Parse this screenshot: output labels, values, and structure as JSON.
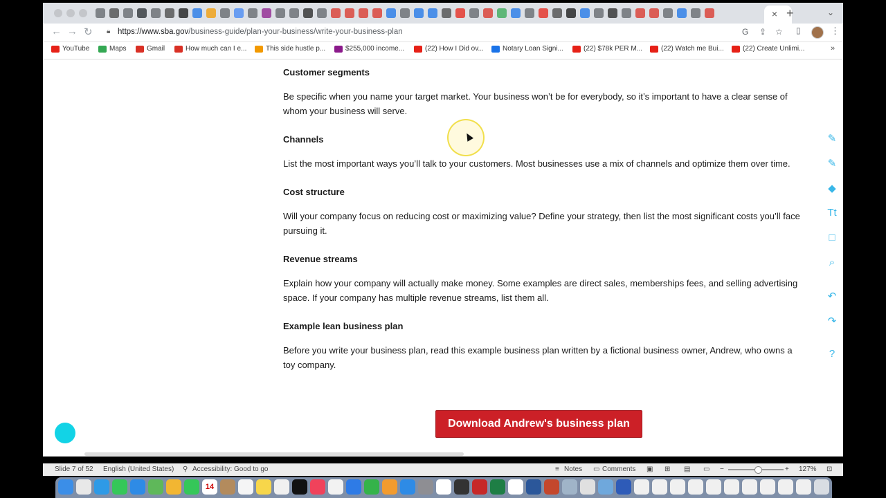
{
  "browser": {
    "url_host": "https://www.sba.gov",
    "url_path": "/business-guide/plan-your-business/write-your-business-plan",
    "close_tab": "×",
    "new_tab": "+",
    "bookmarks": [
      {
        "label": "YouTube",
        "color": "#e62117"
      },
      {
        "label": "Maps",
        "color": "#34a853"
      },
      {
        "label": "Gmail",
        "color": "#d93025"
      },
      {
        "label": "How much can I e...",
        "color": "#d93025"
      },
      {
        "label": "This side hustle p...",
        "color": "#f29900"
      },
      {
        "label": "$255,000 income...",
        "color": "#8b1a8b"
      },
      {
        "label": "(22) How I Did ov...",
        "color": "#e62117"
      },
      {
        "label": "Notary Loan Signi...",
        "color": "#1a73e8"
      },
      {
        "label": "(22) $78k PER M...",
        "color": "#e62117"
      },
      {
        "label": "(22) Watch me Bui...",
        "color": "#e62117"
      },
      {
        "label": "(22) Create Unlimi...",
        "color": "#e62117"
      }
    ]
  },
  "page": {
    "sections": [
      {
        "heading": "Customer segments",
        "body": "Be specific when you name your target market. Your business won’t be for everybody, so it’s important to have a clear sense of whom your business will serve."
      },
      {
        "heading": "Channels",
        "body": "List the most important ways you’ll talk to your customers. Most businesses use a mix of channels and optimize them over time."
      },
      {
        "heading": "Cost structure",
        "body": "Will your company focus on reducing cost or maximizing value? Define your strategy, then list the most significant costs you’ll face pursuing it."
      },
      {
        "heading": "Revenue streams",
        "body": "Explain how your company will actually make money. Some examples are direct sales, memberships fees, and selling advertising space. If your company has multiple revenue streams, list them all."
      },
      {
        "heading": "Example lean business plan",
        "body": "Before you write your business plan, read this example business plan written by a fictional business owner, Andrew, who owns a toy company."
      }
    ],
    "download_button": "Download Andrew's business plan"
  },
  "annotation_tools": [
    {
      "icon": "pen-icon",
      "glyph": "✎"
    },
    {
      "icon": "highlighter-icon",
      "glyph": "✎"
    },
    {
      "icon": "eraser-icon",
      "glyph": "◆"
    },
    {
      "icon": "text-icon",
      "glyph": "Tt"
    },
    {
      "icon": "rectangle-icon",
      "glyph": "□"
    },
    {
      "icon": "zoom-icon",
      "glyph": "⌕"
    },
    {
      "icon": "undo-icon",
      "glyph": "↶"
    },
    {
      "icon": "redo-icon",
      "glyph": "↷"
    },
    {
      "icon": "help-icon",
      "glyph": "?"
    }
  ],
  "statusbar": {
    "slide": "Slide 7 of 52",
    "language": "English (United States)",
    "accessibility": "Accessibility: Good to go",
    "notes": "Notes",
    "comments": "Comments",
    "zoom": "127%"
  },
  "dock": {
    "calendar_date": "14"
  },
  "colors": {
    "accent_red": "#cc2027",
    "tool_blue": "#39b7e8"
  }
}
